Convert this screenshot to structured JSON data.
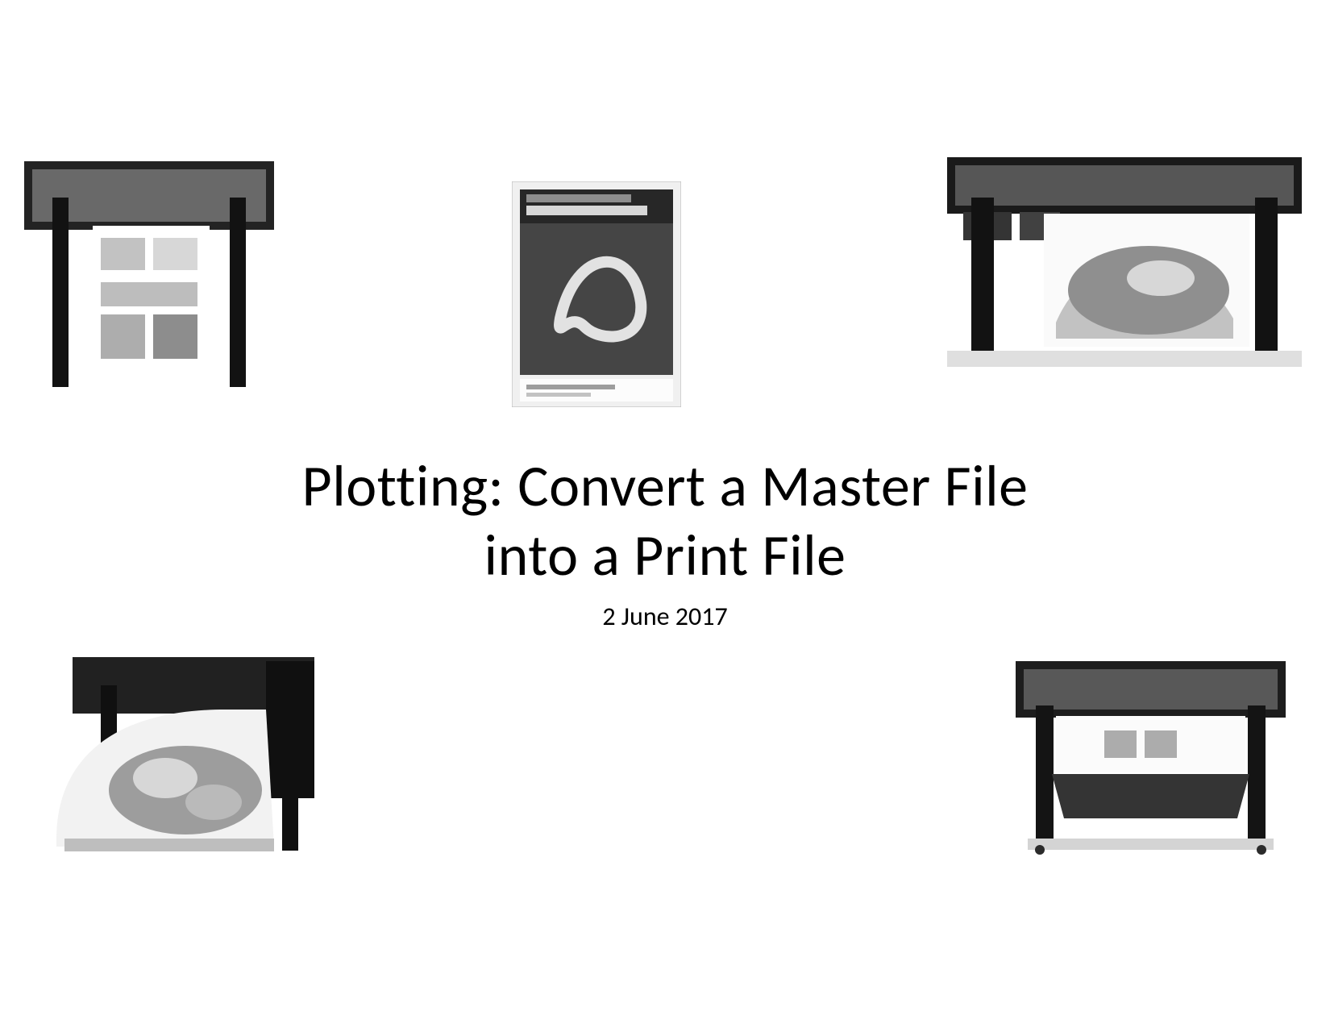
{
  "title": {
    "line1": "Plotting: Convert a Master File",
    "line2": "into a Print File"
  },
  "date": "2 June 2017",
  "images": {
    "top_left": {
      "name": "plotter-a-image",
      "alt": "Large-format plotter printing a sheet"
    },
    "top_center": {
      "name": "acrobat-box-image",
      "alt": "Adobe Acrobat Pro software box"
    },
    "top_right": {
      "name": "plotter-b-image",
      "alt": "Large-format plotter with lizard print"
    },
    "bottom_left": {
      "name": "plotter-c-image",
      "alt": "Large-format plotter printing food photo"
    },
    "bottom_right": {
      "name": "plotter-d-image",
      "alt": "Large-format plotter on stand"
    }
  }
}
